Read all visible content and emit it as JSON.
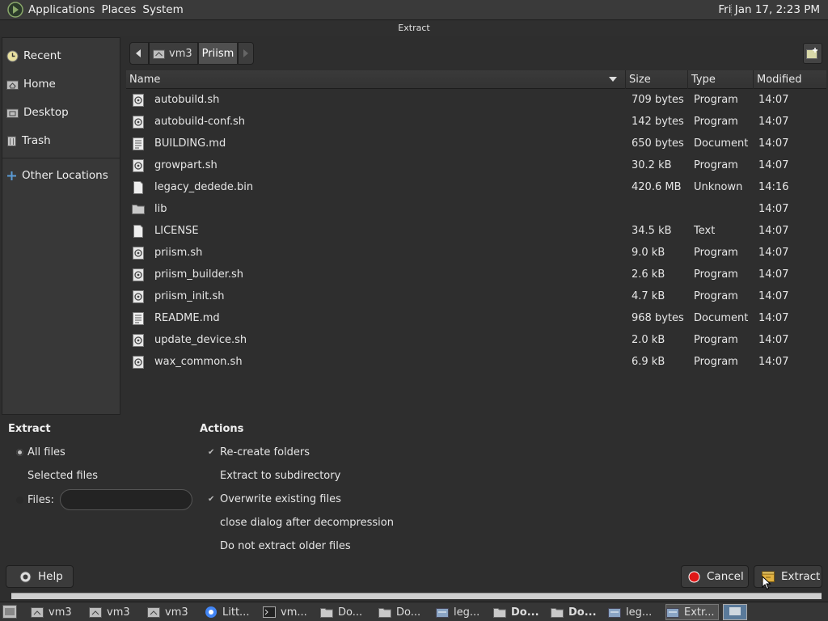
{
  "top_panel": {
    "menus": [
      "Applications",
      "Places",
      "System"
    ],
    "clock": "Fri Jan 17,  2:23 PM"
  },
  "window": {
    "title": "Extract"
  },
  "sidebar": {
    "items": [
      {
        "label": "Recent",
        "icon": "recent-icon"
      },
      {
        "label": "Home",
        "icon": "home-folder-icon"
      },
      {
        "label": "Desktop",
        "icon": "desktop-folder-icon"
      },
      {
        "label": "Trash",
        "icon": "trash-icon"
      },
      {
        "label": "Other Locations",
        "icon": "plus-icon"
      }
    ]
  },
  "pathbar": {
    "segments": [
      "vm3",
      "Priism"
    ]
  },
  "filelist": {
    "columns": [
      "Name",
      "Size",
      "Type",
      "Modified"
    ],
    "rows": [
      {
        "name": "autobuild.sh",
        "size": "709 bytes",
        "type": "Program",
        "modified": "14:07",
        "icon": "script"
      },
      {
        "name": "autobuild-conf.sh",
        "size": "142 bytes",
        "type": "Program",
        "modified": "14:07",
        "icon": "script"
      },
      {
        "name": "BUILDING.md",
        "size": "650 bytes",
        "type": "Document",
        "modified": "14:07",
        "icon": "document"
      },
      {
        "name": "growpart.sh",
        "size": "30.2 kB",
        "type": "Program",
        "modified": "14:07",
        "icon": "script"
      },
      {
        "name": "legacy_dedede.bin",
        "size": "420.6 MB",
        "type": "Unknown",
        "modified": "14:16",
        "icon": "blank"
      },
      {
        "name": "lib",
        "size": "",
        "type": "",
        "modified": "14:07",
        "icon": "folder"
      },
      {
        "name": "LICENSE",
        "size": "34.5 kB",
        "type": "Text",
        "modified": "14:07",
        "icon": "blank"
      },
      {
        "name": "priism.sh",
        "size": "9.0 kB",
        "type": "Program",
        "modified": "14:07",
        "icon": "script"
      },
      {
        "name": "priism_builder.sh",
        "size": "2.6 kB",
        "type": "Program",
        "modified": "14:07",
        "icon": "script"
      },
      {
        "name": "priism_init.sh",
        "size": "4.7 kB",
        "type": "Program",
        "modified": "14:07",
        "icon": "script"
      },
      {
        "name": "README.md",
        "size": "968 bytes",
        "type": "Document",
        "modified": "14:07",
        "icon": "document"
      },
      {
        "name": "update_device.sh",
        "size": "2.0 kB",
        "type": "Program",
        "modified": "14:07",
        "icon": "script"
      },
      {
        "name": "wax_common.sh",
        "size": "6.9 kB",
        "type": "Program",
        "modified": "14:07",
        "icon": "script"
      }
    ]
  },
  "extract_options": {
    "heading": "Extract",
    "all_files": "All files",
    "selected_files": "Selected files",
    "files_label": "Files:",
    "files_value": "",
    "selected": "All files"
  },
  "actions": {
    "heading": "Actions",
    "items": [
      {
        "label": "Re-create folders",
        "checked": true
      },
      {
        "label": "Extract to subdirectory",
        "checked": false
      },
      {
        "label": "Overwrite existing files",
        "checked": true
      },
      {
        "label": "close dialog after decompression",
        "checked": false
      },
      {
        "label": "Do not extract older files",
        "checked": false
      }
    ]
  },
  "buttons": {
    "help": "Help",
    "cancel": "Cancel",
    "extract": "Extract"
  },
  "taskbar": {
    "tasks": [
      "vm3",
      "vm3",
      "vm3",
      "Litt...",
      "vm...",
      "Do...",
      "Do...",
      "leg...",
      "Do...",
      "Do...",
      "leg...",
      "Extr..."
    ]
  }
}
